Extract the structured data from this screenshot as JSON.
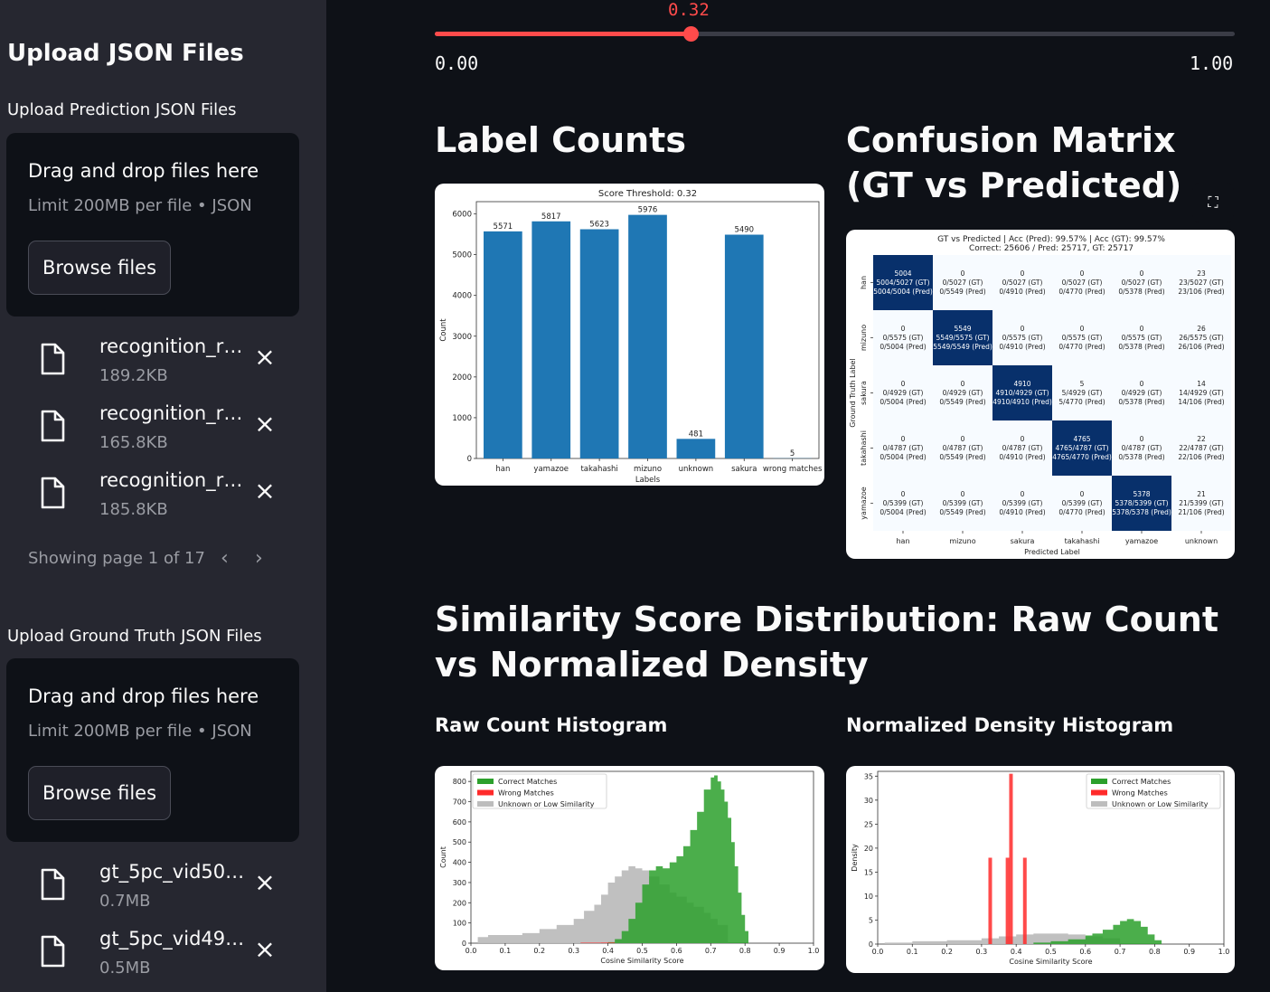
{
  "sidebar": {
    "title": "Upload JSON Files",
    "prediction_label": "Upload Prediction JSON Files",
    "gt_label": "Upload Ground Truth JSON Files",
    "dropzone": {
      "main": "Drag and drop files here",
      "sub": "Limit 200MB per file • JSON",
      "button": "Browse files"
    },
    "prediction_files": [
      {
        "name": "recognition_r…",
        "size": "189.2KB"
      },
      {
        "name": "recognition_r…",
        "size": "165.8KB"
      },
      {
        "name": "recognition_r…",
        "size": "185.8KB"
      }
    ],
    "pager_text": "Showing page 1 of 17",
    "gt_files": [
      {
        "name": "gt_5pc_vid50…",
        "size": "0.7MB"
      },
      {
        "name": "gt_5pc_vid49…",
        "size": "0.5MB"
      }
    ]
  },
  "slider": {
    "value": "0.32",
    "value_num": 0.32,
    "min": "0.00",
    "max": "1.00"
  },
  "sections": {
    "label_counts": "Label Counts",
    "confusion": "Confusion Matrix (GT vs Predicted)",
    "similarity": "Similarity Score Distribution: Raw Count vs Normalized Density",
    "raw_hist": "Raw Count Histogram",
    "norm_hist": "Normalized Density Histogram"
  },
  "colors": {
    "accent": "#ff4b4b",
    "bar": "#1f77b4",
    "correct": "#2ca02c",
    "wrong": "#ff2a2a",
    "unknown": "#bdbdbd",
    "cm_dark": "#08306b",
    "cm_light": "#f7fbff"
  },
  "chart_data": [
    {
      "type": "bar",
      "title": "Score Threshold: 0.32",
      "xlabel": "Labels",
      "ylabel": "Count",
      "categories": [
        "han",
        "yamazoe",
        "takahashi",
        "mizuno",
        "unknown",
        "sakura",
        "wrong matches"
      ],
      "values": [
        5571,
        5817,
        5623,
        5976,
        481,
        5490,
        5
      ],
      "ylim": [
        0,
        6000
      ],
      "yticks": [
        0,
        1000,
        2000,
        3000,
        4000,
        5000,
        6000
      ]
    },
    {
      "type": "heatmap",
      "title_line1": "GT vs Predicted | Acc (Pred): 99.57% | Acc (GT): 99.57%",
      "title_line2": "Correct: 25606 / Pred: 25717, GT: 25717",
      "xlabel": "Predicted Label",
      "ylabel": "Ground Truth Label",
      "x_labels": [
        "han",
        "mizuno",
        "sakura",
        "takahashi",
        "yamazoe",
        "unknown"
      ],
      "y_labels": [
        "han",
        "mizuno",
        "sakura",
        "takahashi",
        "yamazoe"
      ],
      "cells": [
        [
          [
            "5004",
            "5004/5027 (GT)",
            "5004/5004 (Pred)"
          ],
          [
            "0",
            "0/5027 (GT)",
            "0/5549 (Pred)"
          ],
          [
            "0",
            "0/5027 (GT)",
            "0/4910 (Pred)"
          ],
          [
            "0",
            "0/5027 (GT)",
            "0/4770 (Pred)"
          ],
          [
            "0",
            "0/5027 (GT)",
            "0/5378 (Pred)"
          ],
          [
            "23",
            "23/5027 (GT)",
            "23/106 (Pred)"
          ]
        ],
        [
          [
            "0",
            "0/5575 (GT)",
            "0/5004 (Pred)"
          ],
          [
            "5549",
            "5549/5575 (GT)",
            "5549/5549 (Pred)"
          ],
          [
            "0",
            "0/5575 (GT)",
            "0/4910 (Pred)"
          ],
          [
            "0",
            "0/5575 (GT)",
            "0/4770 (Pred)"
          ],
          [
            "0",
            "0/5575 (GT)",
            "0/5378 (Pred)"
          ],
          [
            "26",
            "26/5575 (GT)",
            "26/106 (Pred)"
          ]
        ],
        [
          [
            "0",
            "0/4929 (GT)",
            "0/5004 (Pred)"
          ],
          [
            "0",
            "0/4929 (GT)",
            "0/5549 (Pred)"
          ],
          [
            "4910",
            "4910/4929 (GT)",
            "4910/4910 (Pred)"
          ],
          [
            "5",
            "5/4929 (GT)",
            "5/4770 (Pred)"
          ],
          [
            "0",
            "0/4929 (GT)",
            "0/5378 (Pred)"
          ],
          [
            "14",
            "14/4929 (GT)",
            "14/106 (Pred)"
          ]
        ],
        [
          [
            "0",
            "0/4787 (GT)",
            "0/5004 (Pred)"
          ],
          [
            "0",
            "0/4787 (GT)",
            "0/5549 (Pred)"
          ],
          [
            "0",
            "0/4787 (GT)",
            "0/4910 (Pred)"
          ],
          [
            "4765",
            "4765/4787 (GT)",
            "4765/4770 (Pred)"
          ],
          [
            "0",
            "0/4787 (GT)",
            "0/5378 (Pred)"
          ],
          [
            "22",
            "22/4787 (GT)",
            "22/106 (Pred)"
          ]
        ],
        [
          [
            "0",
            "0/5399 (GT)",
            "0/5004 (Pred)"
          ],
          [
            "0",
            "0/5399 (GT)",
            "0/5549 (Pred)"
          ],
          [
            "0",
            "0/5399 (GT)",
            "0/4910 (Pred)"
          ],
          [
            "0",
            "0/5399 (GT)",
            "0/4770 (Pred)"
          ],
          [
            "5378",
            "5378/5399 (GT)",
            "5378/5378 (Pred)"
          ],
          [
            "21",
            "21/5399 (GT)",
            "21/106 (Pred)"
          ]
        ]
      ]
    },
    {
      "type": "area",
      "xlabel": "Cosine Similarity Score",
      "ylabel": "Count",
      "xlim": [
        0.0,
        1.0
      ],
      "ylim": [
        0,
        850
      ],
      "xticks": [
        0.0,
        0.1,
        0.2,
        0.3,
        0.4,
        0.5,
        0.6,
        0.7,
        0.8,
        0.9,
        1.0
      ],
      "yticks": [
        0,
        100,
        200,
        300,
        400,
        500,
        600,
        700,
        800
      ],
      "legend": [
        "Correct Matches",
        "Wrong Matches",
        "Unknown or Low Similarity"
      ],
      "legend_position": "top-left",
      "series": [
        {
          "name": "Unknown or Low Similarity",
          "x": [
            0.02,
            0.05,
            0.1,
            0.15,
            0.2,
            0.25,
            0.3,
            0.33,
            0.36,
            0.38,
            0.4,
            0.42,
            0.44,
            0.46,
            0.48,
            0.5,
            0.52,
            0.55,
            0.58,
            0.6,
            0.63,
            0.65,
            0.68,
            0.7,
            0.72,
            0.75
          ],
          "values": [
            30,
            40,
            40,
            50,
            70,
            90,
            120,
            160,
            190,
            240,
            300,
            330,
            360,
            380,
            370,
            360,
            330,
            290,
            250,
            230,
            200,
            180,
            150,
            120,
            90,
            40
          ]
        },
        {
          "name": "Correct Matches",
          "x": [
            0.4,
            0.42,
            0.44,
            0.46,
            0.48,
            0.5,
            0.52,
            0.54,
            0.56,
            0.58,
            0.6,
            0.62,
            0.64,
            0.66,
            0.68,
            0.7,
            0.71,
            0.72,
            0.73,
            0.74,
            0.75,
            0.76,
            0.77,
            0.78,
            0.79,
            0.8,
            0.81
          ],
          "values": [
            5,
            20,
            60,
            120,
            200,
            290,
            360,
            380,
            370,
            400,
            430,
            480,
            560,
            650,
            760,
            820,
            830,
            800,
            760,
            700,
            620,
            500,
            380,
            250,
            140,
            60,
            20
          ]
        },
        {
          "name": "Wrong Matches",
          "x": [
            0.32,
            0.38,
            0.42
          ],
          "values": [
            2,
            3,
            2
          ]
        }
      ]
    },
    {
      "type": "area",
      "xlabel": "Cosine Similarity Score",
      "ylabel": "Density",
      "xlim": [
        0.0,
        1.0
      ],
      "ylim": [
        0,
        36
      ],
      "xticks": [
        0.0,
        0.1,
        0.2,
        0.3,
        0.4,
        0.5,
        0.6,
        0.7,
        0.8,
        0.9,
        1.0
      ],
      "yticks": [
        0,
        5,
        10,
        15,
        20,
        25,
        30,
        35
      ],
      "legend": [
        "Correct Matches",
        "Wrong Matches",
        "Unknown or Low Similarity"
      ],
      "legend_position": "top-right",
      "series": [
        {
          "name": "Unknown or Low Similarity",
          "x": [
            0.02,
            0.1,
            0.2,
            0.3,
            0.35,
            0.4,
            0.45,
            0.5,
            0.55,
            0.6,
            0.65,
            0.7
          ],
          "values": [
            0.3,
            0.6,
            0.8,
            1.2,
            1.6,
            2.0,
            2.2,
            2.2,
            2.0,
            1.6,
            1.2,
            0.6
          ]
        },
        {
          "name": "Correct Matches",
          "x": [
            0.45,
            0.5,
            0.55,
            0.6,
            0.62,
            0.65,
            0.68,
            0.7,
            0.72,
            0.74,
            0.76,
            0.78,
            0.8,
            0.82
          ],
          "values": [
            0.3,
            0.6,
            1.0,
            1.8,
            2.2,
            3.0,
            4.0,
            4.8,
            5.2,
            4.8,
            3.6,
            2.0,
            0.8,
            0.2
          ]
        },
        {
          "name": "Wrong Matches",
          "x": [
            0.325,
            0.375,
            0.385,
            0.425
          ],
          "values": [
            18,
            18,
            35.5,
            18
          ]
        }
      ]
    }
  ]
}
